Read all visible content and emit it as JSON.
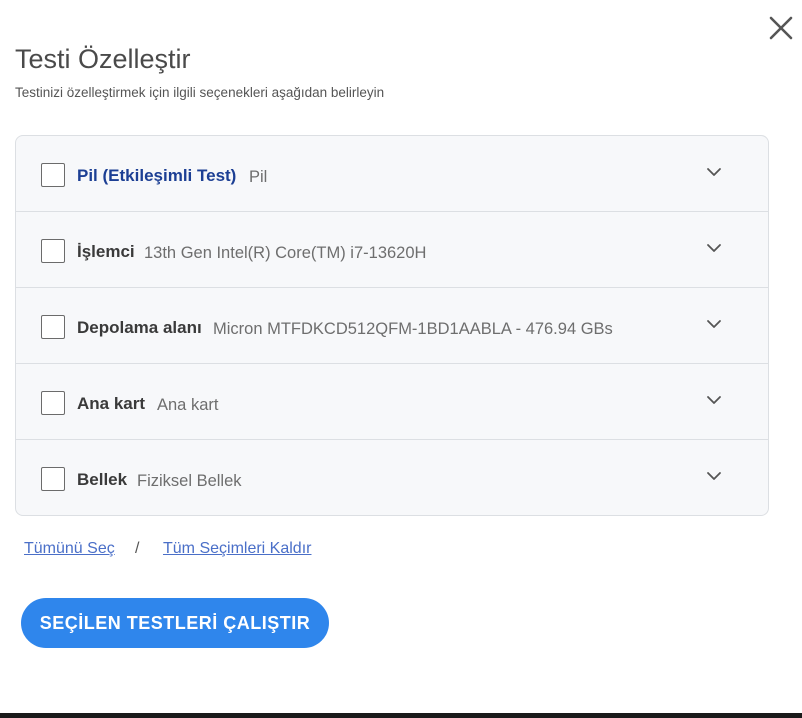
{
  "dialog": {
    "title": "Testi Özelleştir",
    "subtitle": "Testinizi özelleştirmek için ilgili seçenekleri aşağıdan belirleyin",
    "close_icon": "close-icon"
  },
  "tests": [
    {
      "label": "Pil (Etkileşimli Test)",
      "detail": "Pil",
      "checked": false
    },
    {
      "label": "İşlemci",
      "detail": "13th Gen Intel(R) Core(TM) i7-13620H",
      "checked": false
    },
    {
      "label": "Depolama alanı",
      "detail": "Micron MTFDKCD512QFM-1BD1AABLA - 476.94 GBs",
      "checked": false
    },
    {
      "label": "Ana kart",
      "detail": "Ana kart",
      "checked": false
    },
    {
      "label": "Bellek",
      "detail": "Fiziksel Bellek",
      "checked": false
    }
  ],
  "selection": {
    "select_all": "Tümünü Seç",
    "separator": "/",
    "clear_all": "Tüm Seçimleri Kaldır"
  },
  "actions": {
    "run_label": "SEÇİLEN TESTLERİ ÇALIŞTIR"
  },
  "colors": {
    "accent": "#2f86ec",
    "link": "#4a6fc8",
    "active_label": "#1c3f94",
    "panel_bg": "#f7f8fa",
    "panel_border": "#dcdfe3"
  }
}
